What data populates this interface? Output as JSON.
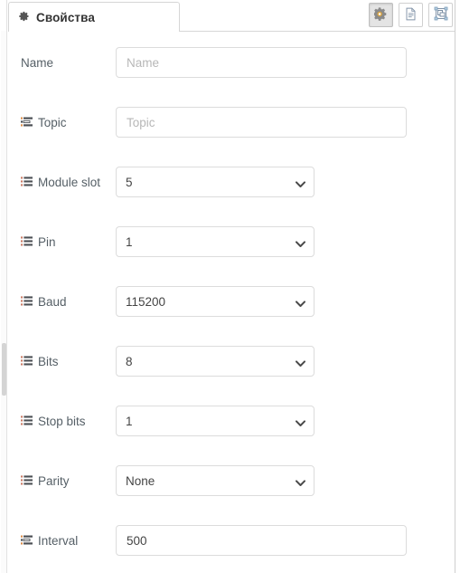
{
  "tab": {
    "icon": "gear-icon",
    "label": "Свойства"
  },
  "toolbar": {
    "buttons": [
      {
        "icon": "gear-icon",
        "name": "properties-button",
        "active": true
      },
      {
        "icon": "document-icon",
        "name": "document-button",
        "active": false
      },
      {
        "icon": "group-select-icon",
        "name": "group-select-button",
        "active": false
      }
    ]
  },
  "colors": {
    "gear_accent": "#d9a441",
    "gear_body": "#8a8a8a",
    "doc_outline": "#8193a8",
    "group_outline": "#8193a8",
    "group_handle": "#8fb3cc",
    "border": "#dcdcdc",
    "label_text": "#555f66",
    "placeholder": "#b7b7b7"
  },
  "fields": [
    {
      "name": "name",
      "label": "Name",
      "icon": "none",
      "control": "text",
      "value": "",
      "placeholder": "Name"
    },
    {
      "name": "topic",
      "label": "Topic",
      "icon": "tasks-icon",
      "control": "text",
      "value": "",
      "placeholder": "Topic"
    },
    {
      "name": "module-slot",
      "label": "Module slot",
      "icon": "list-ul-icon",
      "control": "select",
      "value": "5",
      "options": [
        "5"
      ]
    },
    {
      "name": "pin",
      "label": "Pin",
      "icon": "list-ul-icon",
      "control": "select",
      "value": "1",
      "options": [
        "1"
      ]
    },
    {
      "name": "baud",
      "label": "Baud",
      "icon": "list-ul-icon",
      "control": "select",
      "value": "115200",
      "options": [
        "115200"
      ]
    },
    {
      "name": "bits",
      "label": "Bits",
      "icon": "list-ul-icon",
      "control": "select",
      "value": "8",
      "options": [
        "8"
      ]
    },
    {
      "name": "stop-bits",
      "label": "Stop bits",
      "icon": "list-ul-icon",
      "control": "select",
      "value": "1",
      "options": [
        "1"
      ]
    },
    {
      "name": "parity",
      "label": "Parity",
      "icon": "list-ul-icon",
      "control": "select",
      "value": "None",
      "options": [
        "None"
      ]
    },
    {
      "name": "interval",
      "label": "Interval",
      "icon": "tasks-icon",
      "control": "text",
      "value": "500",
      "placeholder": ""
    }
  ]
}
